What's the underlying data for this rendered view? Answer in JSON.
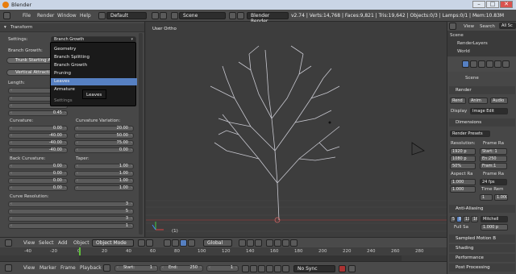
{
  "window": {
    "title": "Blender",
    "min": "–",
    "max": "□",
    "close": "✕"
  },
  "menubar": {
    "file": "File",
    "render": "Render",
    "window": "Window",
    "help": "Help",
    "layout": "Default",
    "scene": "Scene",
    "engine": "Blender Render",
    "stats": "v2.74 | Verts:14,768 | Faces:9,821 | Tris:19,642 | Objects:0/3 | Lamps:0/1 | Mem:10.83M"
  },
  "left_panel": {
    "header": "Transform",
    "settings_label": "Settings:",
    "settings_value": "Branch Growth",
    "branch_growth_label": "Branch Growth:",
    "trunk_start": "Trunk Starting Angle",
    "vert_attraction": "Vertical Attraction",
    "length_label": "Length:",
    "length_values": [
      "",
      "",
      "",
      "0.45"
    ],
    "curvature_label": "Curvature:",
    "curvature_values": [
      "0.00",
      "-40.00",
      "-40.00",
      "-40.00"
    ],
    "curvature_var_label": "Curvature Variation:",
    "curvature_var_values": [
      "20.00",
      "50.00",
      "75.00",
      "0.00"
    ],
    "back_curvature_label": "Back Curvature:",
    "back_curvature_values": [
      "0.00",
      "0.00",
      "0.00",
      "0.00"
    ],
    "taper_label": "Taper:",
    "taper_values": [
      "1.00",
      "1.00",
      "1.00",
      "1.00"
    ],
    "curve_res_label": "Curve Resolution:",
    "curve_res_values": [
      "3",
      "5",
      "3",
      "1"
    ]
  },
  "dropdown": {
    "items": [
      {
        "label": "Geometry"
      },
      {
        "label": "Branch Splitting"
      },
      {
        "label": "Branch Growth"
      },
      {
        "label": "Pruning"
      },
      {
        "label": "Leaves"
      },
      {
        "label": "Armature"
      },
      {
        "label": "Settings"
      }
    ],
    "tooltip": "Leaves"
  },
  "viewport": {
    "label": "User Ortho",
    "frame_label": "(1)"
  },
  "viewport_header": {
    "view": "View",
    "select": "Select",
    "add": "Add",
    "object": "Object",
    "mode": "Object Mode",
    "orientation": "Global"
  },
  "timeline": {
    "ticks": [
      "-40",
      "-20",
      "0",
      "20",
      "40",
      "60",
      "80",
      "100",
      "120",
      "140",
      "160",
      "180",
      "200",
      "220",
      "240",
      "260",
      "280"
    ],
    "view": "View",
    "marker": "Marker",
    "frame": "Frame",
    "playback": "Playback",
    "start_label": "Start:",
    "start": "1",
    "end_label": "End:",
    "end": "250",
    "current": "1",
    "sync": "No Sync"
  },
  "right_panel": {
    "view": "View",
    "search": "Search",
    "all_scenes": "All Sc",
    "scene": "Scene",
    "render_layers": "RenderLayers",
    "world": "World",
    "scene_label": "Scene",
    "render_header": "Render",
    "render_btn": "Rend",
    "anim_btn": "Anim",
    "audio_btn": "Audio",
    "display_label": "Display",
    "display_value": "Image Edit",
    "dimensions_header": "Dimensions",
    "render_presets": "Render Presets",
    "resolution_label": "Resolution:",
    "res_x": "1920 p",
    "res_y": "1080 p",
    "res_pct": "50%",
    "frame_range_label": "Frame Ra",
    "start": "Start: 1",
    "end": "En:250",
    "frame_step": "Fram:1",
    "aspect_label": "Aspect Ra",
    "aspect_x": "1.000",
    "aspect_y": "1.000",
    "frame_rate_label": "Frame Ra",
    "fps": "24 fps",
    "time_rem": "Time Rem",
    "time_a": "1",
    "time_b": "1.000",
    "aa_header": "Anti-Aliasing",
    "aa_5": "5",
    "aa_8": "8",
    "aa_11": "11",
    "aa_16": "16",
    "aa_filter": "Mitchell",
    "full_sample": "Full Sa",
    "filter_size": "1.000 p",
    "motion_blur": "Sampled Motion B",
    "shading": "Shading",
    "performance": "Performance",
    "post_processing": "Post Processing"
  }
}
